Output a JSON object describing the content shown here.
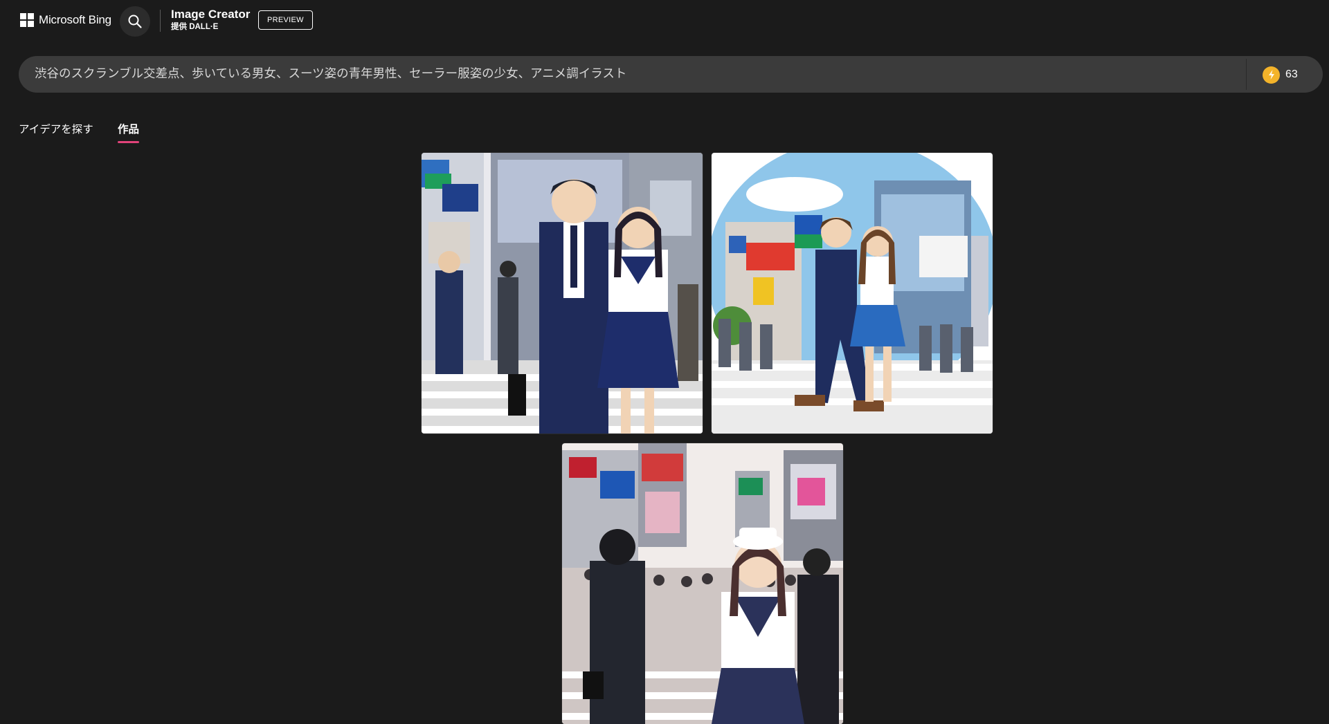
{
  "header": {
    "brand": "Microsoft Bing",
    "app_title": "Image Creator",
    "app_subtitle": "提供 DALL·E",
    "preview_label": "PREVIEW"
  },
  "prompt": {
    "value": "渋谷のスクランブル交差点、歩いている男女、スーツ姿の青年男性、セーラー服姿の少女、アニメ調イラスト",
    "boosts": "63"
  },
  "tabs": [
    {
      "label": "アイデアを探す",
      "active": false
    },
    {
      "label": "作品",
      "active": true
    }
  ],
  "colors": {
    "background": "#1b1b1b",
    "prompt_bar": "#3b3b3b",
    "active_tab_underline": "#e2437a",
    "coin": "#f3b32a"
  },
  "icons": {
    "search": "search-icon",
    "coin": "boost-coin-icon",
    "logo": "microsoft-logo-icon"
  }
}
